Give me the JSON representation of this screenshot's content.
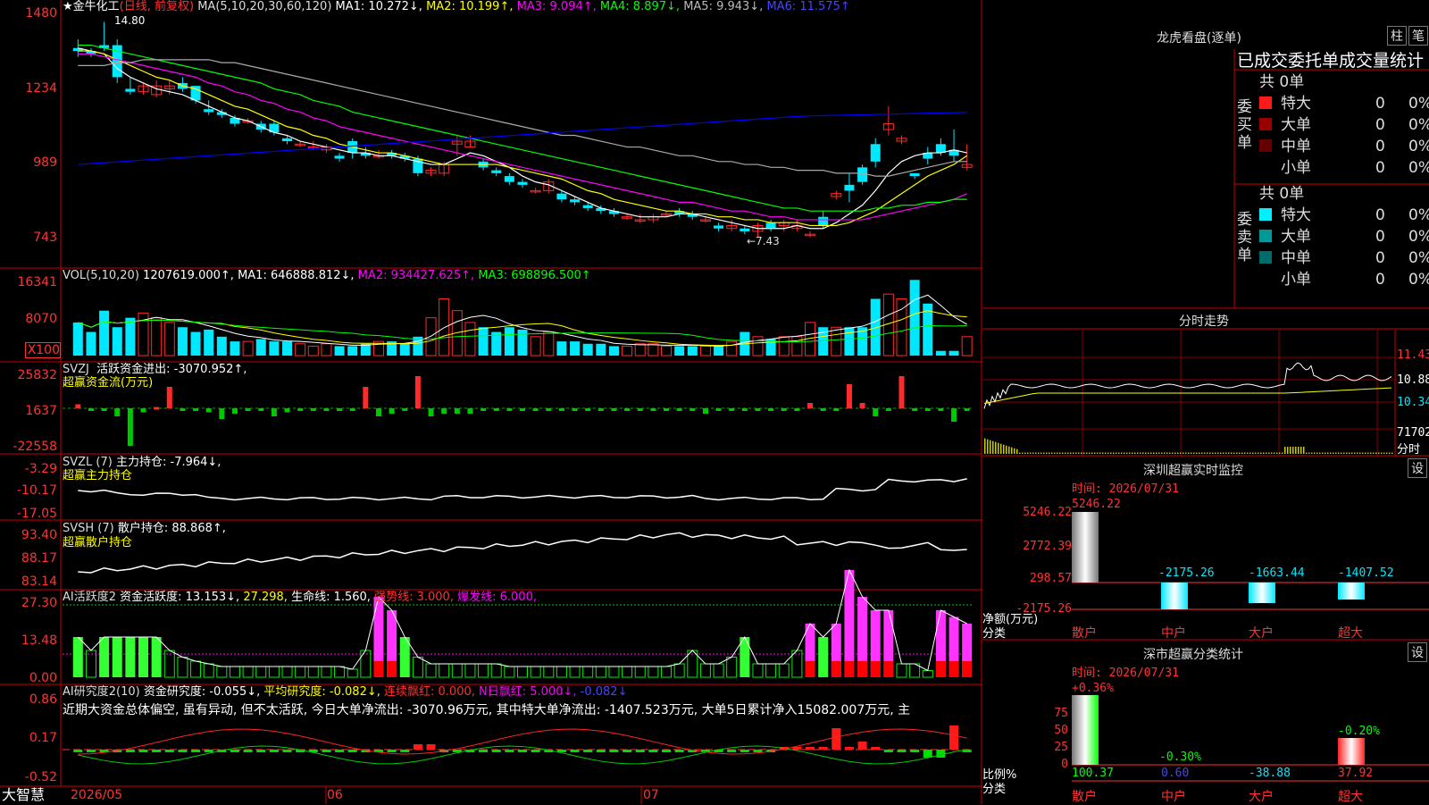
{
  "colors": {
    "up": "#ff2a2a",
    "down": "#00e8ff",
    "ma1": "#ffffff",
    "ma2": "#ffff00",
    "ma3": "#ff00ff",
    "ma4": "#00ff00",
    "ma5": "#aaaaaa",
    "ma6": "#0000ff",
    "axis": "#ff3333",
    "border": "#cc0000"
  },
  "main": {
    "stock_title": "★金牛化工",
    "period": "(日线, 前复权)",
    "ma_params": "MA(5,10,20,30,60,120)",
    "ma1": "MA1: 10.272↓,",
    "ma2": "MA2: 10.199↑,",
    "ma3": "MA3: 9.094↑,",
    "ma4": "MA4: 8.897↓,",
    "ma5": "MA5: 9.943↓,",
    "ma6": "MA6: 11.575↑",
    "axis": [
      "1480",
      "1234",
      "989",
      "743"
    ],
    "high_marker": "14.80",
    "low_marker": "←7.43",
    "candles": [
      [
        13.9,
        14.2,
        13.6,
        13.8
      ],
      [
        13.8,
        13.9,
        13.6,
        13.7
      ],
      [
        14.0,
        14.8,
        13.8,
        13.9
      ],
      [
        14.0,
        14.2,
        12.7,
        12.9
      ],
      [
        12.5,
        12.9,
        12.3,
        12.4
      ],
      [
        12.4,
        12.7,
        12.3,
        12.6
      ],
      [
        12.3,
        12.8,
        12.2,
        12.6
      ],
      [
        12.5,
        12.8,
        12.3,
        12.6
      ],
      [
        12.7,
        12.9,
        12.4,
        12.5
      ],
      [
        12.6,
        12.6,
        12.0,
        12.1
      ],
      [
        11.8,
        12.1,
        11.6,
        11.7
      ],
      [
        11.7,
        11.8,
        11.5,
        11.6
      ],
      [
        11.5,
        11.6,
        11.2,
        11.3
      ],
      [
        11.4,
        11.5,
        11.3,
        11.4
      ],
      [
        11.3,
        11.4,
        11.0,
        11.1
      ],
      [
        11.3,
        11.4,
        10.9,
        11.0
      ],
      [
        10.8,
        10.9,
        10.6,
        10.7
      ],
      [
        10.6,
        10.7,
        10.5,
        10.6
      ],
      [
        10.5,
        10.7,
        10.4,
        10.5
      ],
      [
        10.4,
        10.6,
        10.3,
        10.5
      ],
      [
        10.2,
        10.3,
        10.0,
        10.1
      ],
      [
        10.7,
        10.8,
        10.1,
        10.3
      ],
      [
        10.3,
        10.5,
        10.1,
        10.2
      ],
      [
        10.2,
        10.4,
        10.1,
        10.2
      ],
      [
        10.3,
        10.4,
        10.1,
        10.2
      ],
      [
        10.2,
        10.3,
        10.0,
        10.1
      ],
      [
        10.1,
        10.2,
        9.5,
        9.6
      ],
      [
        9.6,
        9.8,
        9.5,
        9.7
      ],
      [
        9.6,
        10.0,
        9.5,
        9.9
      ],
      [
        10.6,
        10.9,
        10.2,
        10.7
      ],
      [
        10.5,
        10.9,
        10.5,
        10.7
      ],
      [
        10.0,
        10.1,
        9.7,
        9.8
      ],
      [
        9.7,
        9.8,
        9.5,
        9.6
      ],
      [
        9.5,
        9.6,
        9.2,
        9.3
      ],
      [
        9.3,
        9.4,
        9.1,
        9.2
      ],
      [
        9.0,
        9.1,
        8.9,
        9.0
      ],
      [
        9.0,
        9.4,
        8.9,
        9.3
      ],
      [
        8.9,
        9.0,
        8.6,
        8.7
      ],
      [
        8.7,
        8.8,
        8.5,
        8.6
      ],
      [
        8.5,
        8.6,
        8.3,
        8.4
      ],
      [
        8.4,
        8.5,
        8.2,
        8.3
      ],
      [
        8.3,
        8.4,
        8.1,
        8.2
      ],
      [
        8.1,
        8.2,
        8.0,
        8.1
      ],
      [
        8.0,
        8.2,
        7.9,
        8.0
      ],
      [
        8.0,
        8.2,
        7.9,
        8.1
      ],
      [
        8.2,
        8.3,
        8.1,
        8.2
      ],
      [
        8.3,
        8.4,
        8.1,
        8.2
      ],
      [
        8.2,
        8.3,
        8.0,
        8.1
      ],
      [
        8.0,
        8.1,
        7.9,
        8.0
      ],
      [
        7.8,
        7.9,
        7.6,
        7.7
      ],
      [
        7.7,
        8.0,
        7.6,
        7.8
      ],
      [
        7.7,
        7.8,
        7.5,
        7.6
      ],
      [
        7.6,
        7.9,
        7.4,
        7.8
      ],
      [
        7.9,
        8.0,
        7.6,
        7.7
      ],
      [
        7.8,
        8.0,
        7.6,
        7.9
      ],
      [
        7.7,
        8.0,
        7.6,
        7.8
      ],
      [
        7.5,
        7.6,
        7.4,
        7.5
      ],
      [
        8.1,
        8.3,
        7.7,
        7.8
      ],
      [
        8.8,
        9.0,
        8.7,
        8.9
      ],
      [
        9.2,
        9.6,
        8.6,
        9.0
      ],
      [
        9.8,
        9.9,
        9.2,
        9.3
      ],
      [
        10.6,
        10.8,
        9.8,
        10.0
      ],
      [
        11.1,
        11.9,
        10.9,
        11.3
      ],
      [
        10.7,
        10.9,
        10.6,
        10.8
      ],
      [
        9.6,
        9.6,
        9.4,
        9.5
      ],
      [
        10.3,
        10.5,
        9.9,
        10.1
      ],
      [
        10.6,
        10.8,
        10.2,
        10.3
      ],
      [
        10.4,
        11.1,
        10.0,
        10.2
      ],
      [
        9.8,
        10.6,
        9.7,
        9.9
      ]
    ],
    "ma_series": {
      "ma1": [
        13.9,
        13.8,
        13.7,
        13.2,
        12.9,
        12.7,
        12.5,
        12.4,
        12.3,
        12.1,
        11.9,
        11.7,
        11.5,
        11.4,
        11.2,
        11.0,
        10.9,
        10.7,
        10.6,
        10.5,
        10.4,
        10.3,
        10.3,
        10.2,
        10.2,
        10.1,
        10.0,
        9.9,
        9.9,
        10.1,
        10.3,
        10.2,
        10.0,
        9.8,
        9.5,
        9.3,
        9.2,
        9.0,
        8.8,
        8.6,
        8.4,
        8.3,
        8.2,
        8.1,
        8.1,
        8.1,
        8.2,
        8.2,
        8.1,
        8.0,
        7.9,
        7.8,
        7.7,
        7.7,
        7.7,
        7.8,
        7.7,
        7.7,
        7.9,
        8.2,
        8.5,
        9.0,
        9.6,
        10.0,
        10.2,
        10.3,
        10.3,
        10.4,
        10.3
      ],
      "ma2": [
        13.8,
        13.8,
        13.7,
        13.5,
        13.3,
        13.1,
        12.9,
        12.8,
        12.6,
        12.5,
        12.3,
        12.1,
        11.9,
        11.8,
        11.6,
        11.4,
        11.2,
        11.1,
        10.9,
        10.8,
        10.6,
        10.5,
        10.4,
        10.3,
        10.3,
        10.2,
        10.1,
        10.0,
        9.9,
        9.9,
        9.9,
        9.9,
        9.9,
        9.8,
        9.7,
        9.6,
        9.5,
        9.4,
        9.2,
        9.0,
        8.9,
        8.7,
        8.6,
        8.5,
        8.4,
        8.3,
        8.3,
        8.2,
        8.2,
        8.1,
        8.1,
        8.0,
        8.0,
        7.9,
        7.9,
        7.9,
        7.8,
        7.8,
        7.8,
        7.9,
        8.1,
        8.3,
        8.6,
        8.9,
        9.2,
        9.5,
        9.7,
        9.9,
        10.2
      ],
      "ma3": [
        13.7,
        13.7,
        13.6,
        13.5,
        13.4,
        13.3,
        13.2,
        13.1,
        13.0,
        12.9,
        12.7,
        12.6,
        12.4,
        12.3,
        12.1,
        12.0,
        11.8,
        11.7,
        11.5,
        11.4,
        11.2,
        11.1,
        11.0,
        10.9,
        10.8,
        10.7,
        10.6,
        10.5,
        10.4,
        10.3,
        10.2,
        10.1,
        10.0,
        9.9,
        9.8,
        9.7,
        9.6,
        9.5,
        9.4,
        9.3,
        9.2,
        9.1,
        9.0,
        8.9,
        8.8,
        8.7,
        8.6,
        8.6,
        8.5,
        8.4,
        8.3,
        8.3,
        8.2,
        8.1,
        8.1,
        8.0,
        8.0,
        8.0,
        8.0,
        8.0,
        8.0,
        8.1,
        8.2,
        8.3,
        8.4,
        8.5,
        8.6,
        8.7,
        8.9
      ],
      "ma4": [
        14.0,
        14.0,
        13.9,
        13.8,
        13.7,
        13.6,
        13.5,
        13.4,
        13.3,
        13.2,
        13.1,
        13.0,
        12.9,
        12.8,
        12.7,
        12.5,
        12.4,
        12.3,
        12.1,
        12.0,
        11.9,
        11.7,
        11.6,
        11.5,
        11.4,
        11.3,
        11.2,
        11.1,
        11.0,
        10.9,
        10.8,
        10.7,
        10.6,
        10.5,
        10.4,
        10.3,
        10.2,
        10.1,
        10.0,
        9.9,
        9.8,
        9.7,
        9.6,
        9.5,
        9.4,
        9.3,
        9.2,
        9.1,
        9.0,
        8.9,
        8.8,
        8.7,
        8.6,
        8.5,
        8.4,
        8.4,
        8.3,
        8.3,
        8.3,
        8.3,
        8.3,
        8.4,
        8.4,
        8.5,
        8.5,
        8.6,
        8.6,
        8.7,
        8.7
      ],
      "ma5": [
        13.3,
        13.3,
        13.3,
        13.4,
        13.4,
        13.5,
        13.5,
        13.5,
        13.5,
        13.5,
        13.5,
        13.4,
        13.4,
        13.3,
        13.2,
        13.1,
        13.0,
        12.9,
        12.8,
        12.7,
        12.6,
        12.5,
        12.4,
        12.3,
        12.2,
        12.1,
        12.0,
        11.9,
        11.8,
        11.7,
        11.6,
        11.5,
        11.4,
        11.3,
        11.2,
        11.1,
        11.0,
        10.9,
        10.9,
        10.8,
        10.7,
        10.6,
        10.5,
        10.5,
        10.4,
        10.3,
        10.2,
        10.2,
        10.1,
        10.0,
        10.0,
        9.9,
        9.9,
        9.8,
        9.8,
        9.7,
        9.7,
        9.7,
        9.6,
        9.6,
        9.6,
        9.5,
        9.5,
        9.6,
        9.7,
        9.8,
        9.9,
        10.0,
        10.0
      ],
      "ma6": [
        9.9,
        9.93,
        9.96,
        9.99,
        10.02,
        10.05,
        10.08,
        10.11,
        10.14,
        10.17,
        10.2,
        10.23,
        10.26,
        10.29,
        10.32,
        10.35,
        10.38,
        10.41,
        10.44,
        10.47,
        10.5,
        10.53,
        10.56,
        10.59,
        10.62,
        10.65,
        10.68,
        10.71,
        10.74,
        10.77,
        10.8,
        10.83,
        10.86,
        10.89,
        10.92,
        10.95,
        10.98,
        11.01,
        11.04,
        11.07,
        11.1,
        11.13,
        11.16,
        11.19,
        11.22,
        11.25,
        11.28,
        11.31,
        11.34,
        11.37,
        11.4,
        11.43,
        11.46,
        11.49,
        11.52,
        11.55,
        11.57,
        11.58,
        11.59,
        11.6,
        11.61,
        11.62,
        11.63,
        11.64,
        11.65,
        11.66,
        11.67,
        11.68,
        11.69
      ]
    }
  },
  "vol": {
    "title": "VOL(5,10,20)",
    "value": "1207619.000↑,",
    "ma1": "MA1: 646888.812↓,",
    "ma2": "MA2: 934427.625↑,",
    "ma3": "MA3: 698896.500↑",
    "axis": [
      "16341",
      "8070",
      "X100"
    ],
    "bars": [
      7,
      5,
      9.5,
      6,
      8,
      9,
      8,
      7,
      6,
      5,
      5.5,
      4,
      3,
      3,
      3.5,
      3,
      3,
      2.5,
      2,
      2.5,
      2,
      2,
      2.5,
      3,
      3,
      2.5,
      4,
      8,
      12,
      9.5,
      7,
      6,
      5,
      6,
      5.5,
      4,
      5,
      3,
      3,
      2.5,
      2.5,
      2,
      2,
      2.5,
      2.5,
      2,
      2,
      2,
      2,
      2,
      3,
      5,
      4,
      3.5,
      4,
      4,
      7,
      6,
      6,
      6,
      6,
      12,
      13,
      12,
      16,
      11,
      1,
      1,
      4,
      11.5,
      11
    ]
  },
  "svzj": {
    "title": "SVZJ",
    "label": "活跃资金进出: -3070.952↑,",
    "sub": "超赢资金流(万元)",
    "axis": [
      "25832",
      "1637",
      "-22558"
    ],
    "bars": [
      1.5,
      -1,
      -1,
      -3,
      -14,
      -1.5,
      0.5,
      8,
      -0.5,
      -0.5,
      -1.5,
      -4,
      -2,
      -1,
      -1,
      -3,
      -1.5,
      -1,
      -1,
      -1,
      -1,
      -1,
      8,
      -3,
      -2,
      -1,
      12,
      -3,
      -2,
      -2,
      -2,
      -1,
      -1,
      -1,
      -1,
      -1,
      -1,
      -1,
      -1,
      -1,
      -1,
      -1,
      -1,
      -1,
      -1,
      -1,
      -1,
      -1,
      -2,
      -1,
      -1,
      -1,
      -1,
      -1,
      -1,
      -1,
      2,
      -1,
      -1,
      9,
      2,
      -3,
      -1,
      12,
      -1,
      -1,
      -1,
      -5,
      -1,
      1,
      15,
      -1,
      -2
    ],
    "line": 0
  },
  "svzl": {
    "title": "SVZL (7)",
    "label": "主力持仓: -7.964↓,",
    "sub": "超赢主力持仓",
    "axis": [
      "-3.29",
      "-10.17",
      "-17.05"
    ]
  },
  "svsh": {
    "title": "SVSH (7)",
    "label": "散户持仓: 88.868↑,",
    "sub": "超赢散户持仓",
    "axis": [
      "93.40",
      "88.17",
      "83.14"
    ]
  },
  "ai1": {
    "title": "AI活跃度2",
    "label": "资金活跃度: 13.153↓,",
    "v2": "27.298,",
    "life": "生命线: 1.560,",
    "strong": "强势线: 3.000,",
    "burst": "爆发线: 6.000,",
    "axis": [
      "27.30",
      "13.48",
      "0.00"
    ]
  },
  "ai2": {
    "title": "AI研究度2(10)",
    "label": "资金研究度: -0.055↓,",
    "avg": "平均研究度: -0.082↓,",
    "cont": "连续飘红: 0.000,",
    "nday": "N日飘红: 5.000↓,",
    "last": "-0.082↓",
    "comment": "近期大资金总体偏空, 虽有异动, 但不太活跃, 今日大单净流出: -3070.96万元, 其中特大单净流出: -1407.523万元, 大单5日累计净入15082.007万元, 主",
    "axis": [
      "0.86",
      "0.17",
      "-0.52"
    ]
  },
  "xaxis": {
    "brand": "大智慧",
    "d1": "2026/05",
    "d2": "06",
    "d3": "07"
  },
  "lhb": {
    "title": "龙虎看盘(逐单)",
    "btn1": "柱",
    "btn2": "笔",
    "head": "已成交委托单成交量统计",
    "buy_label": "委买单",
    "sell_label": "委卖单",
    "buy_total": "共 0单",
    "sell_total": "共 0单",
    "buy_rows": [
      {
        "name": "特大",
        "v": "0",
        "p": "0%",
        "c": "#ff1a1a"
      },
      {
        "name": "大单",
        "v": "0",
        "p": "0%",
        "c": "#990000"
      },
      {
        "name": "中单",
        "v": "0",
        "p": "0%",
        "c": "#660000"
      },
      {
        "name": "小单",
        "v": "0",
        "p": "0%",
        "c": "#000000"
      }
    ],
    "sell_rows": [
      {
        "name": "特大",
        "v": "0",
        "p": "0%",
        "c": "#00f0ff"
      },
      {
        "name": "大单",
        "v": "0",
        "p": "0%",
        "c": "#009999"
      },
      {
        "name": "中单",
        "v": "0",
        "p": "0%",
        "c": "#006b6b"
      },
      {
        "name": "小单",
        "v": "0",
        "p": "0%",
        "c": "#000000"
      }
    ]
  },
  "fenshi": {
    "title": "分时走势",
    "axis": [
      "11.43",
      "10.88",
      "10.34",
      "71702"
    ],
    "label": "分时"
  },
  "sz1": {
    "title": "深圳超赢实时监控",
    "btn": "设",
    "time": "时间: 2026/07/31",
    "axis": [
      "5246.22",
      "2772.39",
      "298.57",
      "-2175.26"
    ],
    "top": "5246.22",
    "vals": [
      "-2175.26",
      "-1663.44",
      "-1407.52"
    ],
    "ylabel": "净额(万元)",
    "xlabel": "分类",
    "cats": [
      "散户",
      "中户",
      "大户",
      "超大"
    ]
  },
  "sz2": {
    "title": "深市超赢分类统计",
    "btn": "设",
    "time": "时间: 2026/07/31",
    "axis": [
      "75",
      "50",
      "25",
      "0"
    ],
    "pct1": "+0.36%",
    "pct2": "-0.30%",
    "pct3": "-0.20%",
    "vals": [
      "100.37",
      "0.60",
      "-38.88",
      "37.92"
    ],
    "ylabel": "比例%",
    "xlabel": "分类",
    "cats": [
      "散户",
      "中户",
      "大户",
      "超大"
    ]
  }
}
